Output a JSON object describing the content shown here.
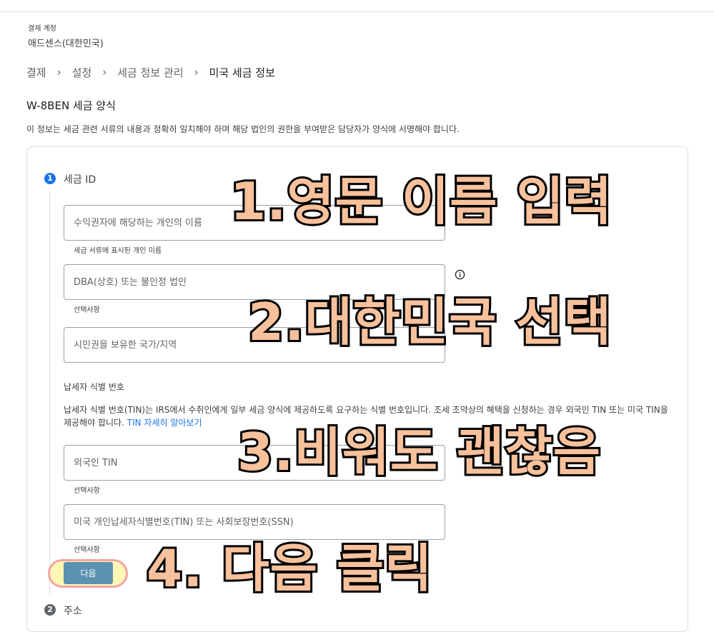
{
  "account": {
    "label": "결제 계정",
    "name": "애드센스(대한민국)"
  },
  "breadcrumb": [
    {
      "label": "결제"
    },
    {
      "label": "설정"
    },
    {
      "label": "세금 정보 관리"
    },
    {
      "label": "미국 세금 정보"
    }
  ],
  "breadcrumb_separator": "›",
  "form": {
    "title": "W-8BEN 세금 양식",
    "description": "이 정보는 세금 관련 서류의 내용과 정확히 일치해야 하며 해당 법인의 권한을 부여받은 담당자가 양식에 서명해야 합니다."
  },
  "steps": [
    {
      "number": "1",
      "title": "세금 ID"
    },
    {
      "number": "2",
      "title": "주소"
    }
  ],
  "fields": {
    "name": {
      "placeholder": "수익권자에 해당하는 개인의 이름",
      "value": "",
      "hint": "세금 서류에 표시된 개인 이름"
    },
    "dba": {
      "placeholder": "DBA(상호) 또는 불인정 법인",
      "value": "",
      "hint": "선택사항"
    },
    "citizenship": {
      "placeholder": "시민권을 보유한 국가/지역",
      "value": ""
    },
    "foreign_tin": {
      "placeholder": "외국인 TIN",
      "value": "",
      "hint": "선택사항"
    },
    "us_tin": {
      "placeholder": "미국 개인납세자식별번호(TIN) 또는 사회보장번호(SSN)",
      "value": "",
      "hint": "선택사항"
    }
  },
  "tin": {
    "section_label": "납세자 식별 번호",
    "description": "납세자 식별 번호(TIN)는 IRS에서 수취인에게 일부 세금 양식에 제공하도록 요구하는 식별 번호입니다. 조세 조약상의 혜택을 신청하는 경우 외국인 TIN 또는 미국 TIN을 제공해야 합니다.",
    "link": "TIN 자세히 알아보기"
  },
  "buttons": {
    "next": "다음"
  },
  "icons": {
    "info": "info-icon"
  },
  "colors": {
    "accent": "#1a73e8",
    "button": "#5b92b1",
    "overlay_fill": "#f7c19c",
    "overlay_stroke": "#000000",
    "highlight": "#fdf7b3"
  },
  "annotations": {
    "a1": "1.영문 이름 입력",
    "a2": "2.대한민국 선택",
    "a3": "3.비워도 괜찮음",
    "a4": "4. 다음 클릭"
  }
}
